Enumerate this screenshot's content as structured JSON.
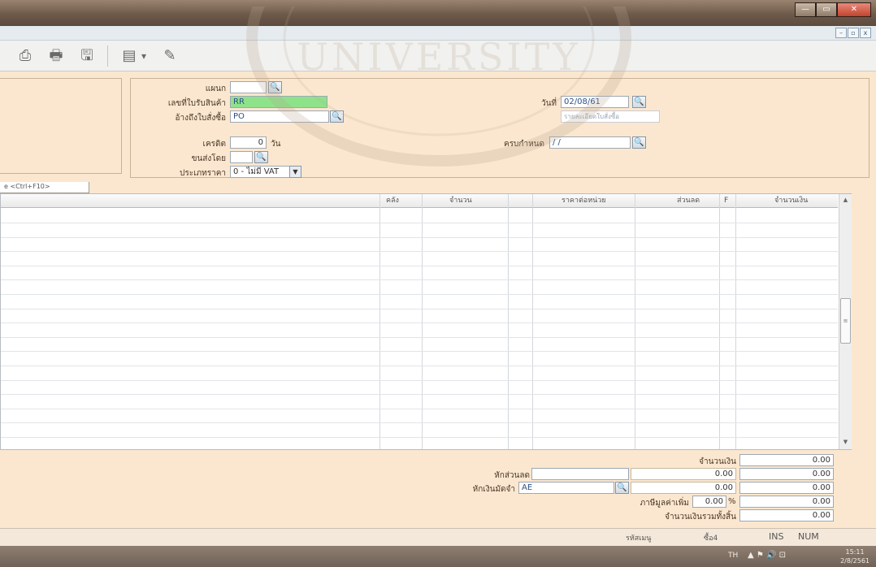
{
  "window": {
    "controls": {
      "minimize": "—",
      "maximize": "▭",
      "close": "✕"
    },
    "mdi_controls": {
      "minimize": "–",
      "restore": "▫",
      "close": "x"
    }
  },
  "toolbar": {
    "icons": [
      "printer-icon",
      "preview-icon",
      "save-icon",
      "print-menu-icon",
      "attach-icon"
    ],
    "glyphs": {
      "printer": "⎙",
      "preview": "🖶",
      "save": "🖫",
      "print_menu": "▤",
      "dropdown": "▾",
      "attach": "✎"
    }
  },
  "header": {
    "branch_label": "แผนก",
    "branch_value": "",
    "receipt_no_label": "เลขที่ใบรับสินค้า",
    "receipt_no_value": "RR",
    "po_ref_label": "อ้างถึงใบสั่งซื้อ",
    "po_ref_value": "PO",
    "date_label": "วันที่",
    "date_value": "02/08/61",
    "po_hint": "รายละเอียดใบสั่งซื้อ",
    "credit_label": "เครดิต",
    "credit_value": "0",
    "credit_unit": "วัน",
    "ship_by_label": "ขนส่งโดย",
    "ship_by_value": "",
    "due_label": "ครบกำหนด",
    "due_value": " / /",
    "price_type_label": "ประเภทราคา",
    "price_type_value": "0 - ไม่มี VAT",
    "lookup_glyph": "🔍",
    "dropdown_glyph": "▼"
  },
  "tab": {
    "label": "e <Ctrl+F10>"
  },
  "grid": {
    "columns": [
      "คลัง",
      "จำนวน",
      "ราคาต่อหน่วย",
      "ส่วนลด",
      "F",
      "จำนวนเงิน"
    ],
    "rows": [],
    "scroll": {
      "up": "▲",
      "down": "▼",
      "thumb": "≡"
    }
  },
  "totals": {
    "amount_label": "จำนวนเงิน",
    "amount_value": "0.00",
    "discount_label": "หักส่วนลด",
    "discount_input": "",
    "discount_value": "0.00",
    "discount_total": "0.00",
    "deposit_label": "หักเงินมัดจำ",
    "deposit_input": "AE",
    "deposit_value": "0.00",
    "deposit_total": "0.00",
    "vat_label": "ภาษีมูลค่าเพิ่ม",
    "vat_rate": "0.00",
    "vat_unit": "%",
    "vat_total": "0.00",
    "grand_total_label": "จำนวนเงินรวมทั้งสิ้น",
    "grand_total_value": "0.00"
  },
  "statusbar": {
    "hint1": "รหัสเมนู",
    "hint2": "ซื้อ4",
    "ins": "INS",
    "num": "NUM"
  },
  "taskbar": {
    "lang": "TH",
    "tray_icons": "▲  ⚑  🔊  ⊡",
    "time": "15:11",
    "date": "2/8/2561"
  }
}
